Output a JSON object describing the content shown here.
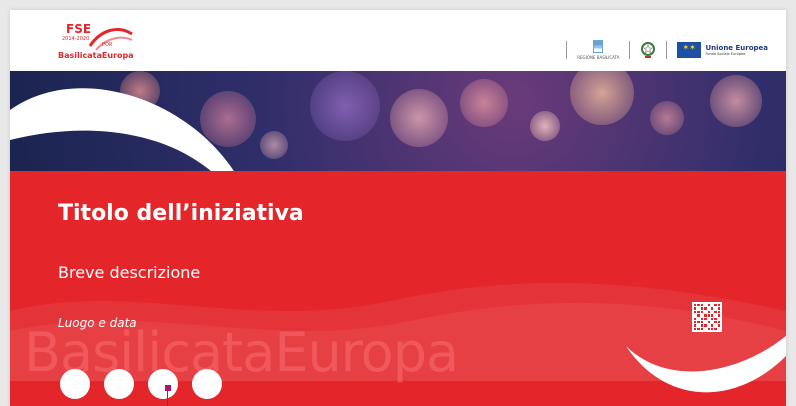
{
  "header": {
    "logo": {
      "fse": "FSE",
      "years": "2014-2020",
      "por": "POR",
      "brand": "BasilicataEuropa"
    },
    "partners": {
      "regione_label": "REGIONE BASILICATA",
      "eu_title": "Unione Europea",
      "eu_subtitle": "Fondo Sociale Europeo"
    }
  },
  "content": {
    "title": "Titolo dell’iniziativa",
    "subtitle": "Breve descrizione",
    "place_date": "Luogo e data",
    "watermark": "BasilicataEuropa"
  },
  "colors": {
    "accent_red": "#e4252a",
    "banner_dark": "#1b2450",
    "cursor": "#b1126a"
  },
  "icons": [
    "fse-logo-icon",
    "regione-basilicata-icon",
    "italian-emblem-icon",
    "eu-flag-icon",
    "qr-code-icon"
  ]
}
